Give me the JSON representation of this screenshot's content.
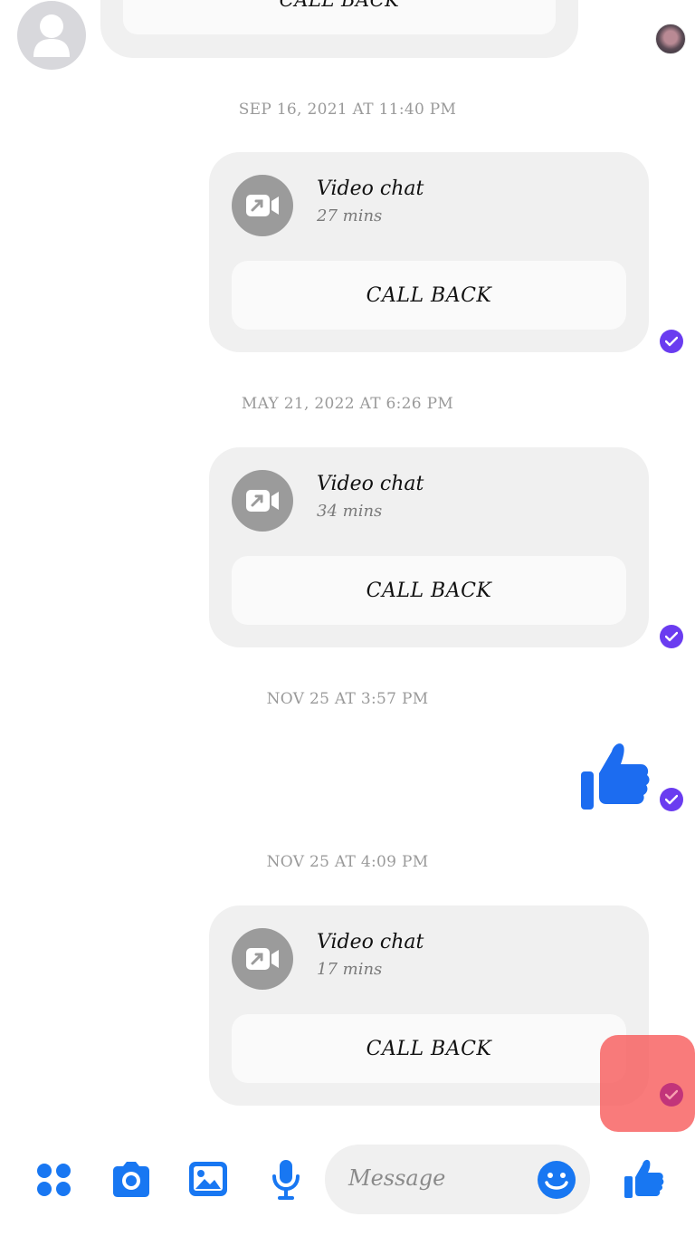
{
  "thread": {
    "top_callback_label": "CALL BACK",
    "messages": [
      {
        "timestamp": "SEP 16, 2021 AT 11:40 PM",
        "title": "Video chat",
        "duration": "27 mins",
        "callback_label": "CALL BACK"
      },
      {
        "timestamp": "MAY 21, 2022 AT 6:26 PM",
        "title": "Video chat",
        "duration": "34 mins",
        "callback_label": "CALL BACK"
      },
      {
        "timestamp": "NOV 25 AT 3:57 PM",
        "type": "like"
      },
      {
        "timestamp": "NOV 25 AT 4:09 PM",
        "title": "Video chat",
        "duration": "17 mins",
        "callback_label": "CALL BACK"
      }
    ]
  },
  "composer": {
    "placeholder": "Message",
    "icons": [
      "menu-dots-icon",
      "camera-icon",
      "gallery-icon",
      "microphone-icon",
      "emoji-icon",
      "thumbs-up-icon"
    ]
  },
  "colors": {
    "accent": "#1877f2",
    "receipt": "#6a3cf0",
    "bubble": "#f0f0f0",
    "highlight": "#f85a5a"
  }
}
